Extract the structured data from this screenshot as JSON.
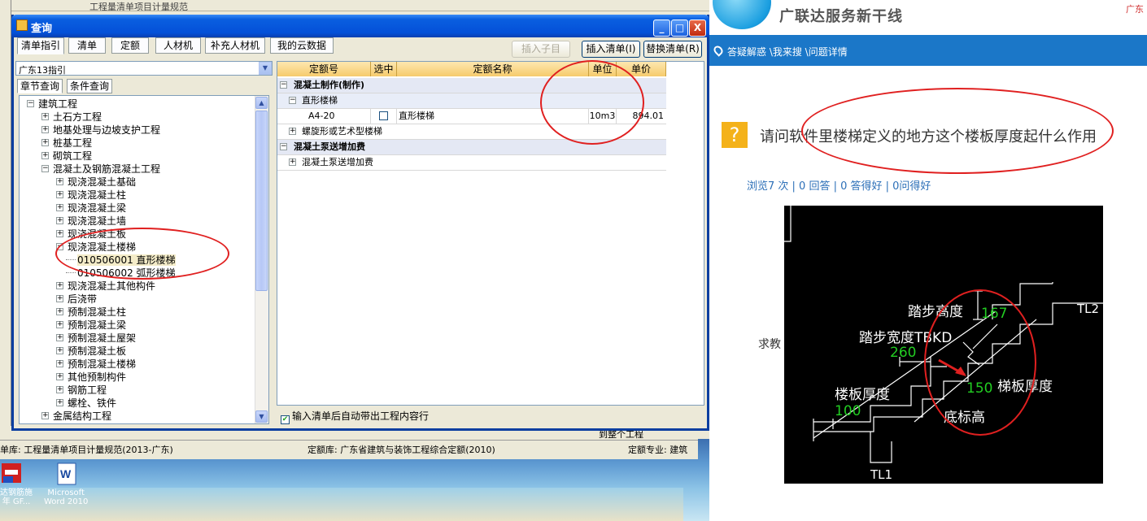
{
  "app": {
    "top_bar_text": "工程量清单项目计量规范",
    "status_left": "单库: 工程量清单项目计量规范(2013-广东)",
    "status_mid": "定额库: 广东省建筑与装饰工程综合定额(2010)",
    "status_right": "定额专业: 建筑",
    "behind_label": "到整个工程"
  },
  "dialog": {
    "title": "查询",
    "caption_min": "_",
    "caption_max": "□",
    "caption_close": "X",
    "tabs": [
      "清单指引",
      "清单",
      "定额",
      "人材机",
      "补充人材机",
      "我的云数据"
    ],
    "btn_insert_child": "插入子目",
    "btn_insert_list": "插入清单(I)",
    "btn_replace_list": "替换清单(R)",
    "combo_value": "广东13指引",
    "subtabs": [
      "章节查询",
      "条件查询"
    ],
    "tree": [
      {
        "label": "建筑工程",
        "level": 0,
        "sign": "−"
      },
      {
        "label": "土石方工程",
        "level": 1,
        "sign": "+"
      },
      {
        "label": "地基处理与边坡支护工程",
        "level": 1,
        "sign": "+"
      },
      {
        "label": "桩基工程",
        "level": 1,
        "sign": "+"
      },
      {
        "label": "砌筑工程",
        "level": 1,
        "sign": "+"
      },
      {
        "label": "混凝土及钢筋混凝土工程",
        "level": 1,
        "sign": "−"
      },
      {
        "label": "现浇混凝土基础",
        "level": 2,
        "sign": "+"
      },
      {
        "label": "现浇混凝土柱",
        "level": 2,
        "sign": "+"
      },
      {
        "label": "现浇混凝土梁",
        "level": 2,
        "sign": "+"
      },
      {
        "label": "现浇混凝土墙",
        "level": 2,
        "sign": "+"
      },
      {
        "label": "现浇混凝土板",
        "level": 2,
        "sign": "+"
      },
      {
        "label": "现浇混凝土楼梯",
        "level": 2,
        "sign": "−"
      },
      {
        "label": "010506001  直形楼梯",
        "level": 3,
        "sign": ""
      },
      {
        "label": "010506002  弧形楼梯",
        "level": 3,
        "sign": ""
      },
      {
        "label": "现浇混凝土其他构件",
        "level": 2,
        "sign": "+"
      },
      {
        "label": "后浇带",
        "level": 2,
        "sign": "+"
      },
      {
        "label": "预制混凝土柱",
        "level": 2,
        "sign": "+"
      },
      {
        "label": "预制混凝土梁",
        "level": 2,
        "sign": "+"
      },
      {
        "label": "预制混凝土屋架",
        "level": 2,
        "sign": "+"
      },
      {
        "label": "预制混凝土板",
        "level": 2,
        "sign": "+"
      },
      {
        "label": "预制混凝土楼梯",
        "level": 2,
        "sign": "+"
      },
      {
        "label": "其他预制构件",
        "level": 2,
        "sign": "+"
      },
      {
        "label": "钢筋工程",
        "level": 2,
        "sign": "+"
      },
      {
        "label": "螺栓、铁件",
        "level": 2,
        "sign": "+"
      },
      {
        "label": "金属结构工程",
        "level": 1,
        "sign": "+"
      }
    ],
    "grid_headers": [
      "定额号",
      "选中",
      "定额名称",
      "单位",
      "单价"
    ],
    "grid_rows": [
      {
        "group": "混凝土制作(制作)",
        "sign": "−",
        "bold": true
      },
      {
        "group": "直形楼梯",
        "sign": "−",
        "bold": false
      },
      {
        "code": "A4-20",
        "name": "直形楼梯",
        "unit": "10m3",
        "price": "894.01"
      },
      {
        "group": "螺旋形或艺术型楼梯",
        "sign": "+",
        "bold": false
      },
      {
        "group": "混凝土泵送增加费",
        "sign": "−",
        "bold": true
      },
      {
        "group": "混凝土泵送增加费",
        "sign": "+",
        "bold": false
      }
    ],
    "checkbox_label": "输入清单后自动带出工程内容行"
  },
  "desktop": {
    "icons": [
      {
        "name": "广联达钢筋施工 GF...",
        "label1": "达钢筋施",
        "label2": "年 GF..."
      },
      {
        "name": "Microsoft Word 2010",
        "label1": "Microsoft",
        "label2": "Word 2010"
      }
    ]
  },
  "web": {
    "brand": "广联达服务新干线",
    "corner": "广东",
    "breadcrumb": "答疑解惑 \\我来搜 \\问题详情",
    "question_badge": "?",
    "question_title": "请问软件里楼梯定义的地方这个楼板厚度起什么作用",
    "stats": "浏览7 次 | 0 回答 | 0 答得好 | 0问得好",
    "ask_text": "求教",
    "figure": {
      "labels": [
        "踏步高度",
        "167",
        "踏步宽度TBKD",
        "260",
        "150",
        "梯板厚度",
        "楼板厚度",
        "100",
        "底标高",
        "TL1",
        "TL2"
      ]
    }
  },
  "colors": {
    "accent_blue": "#1b77c8",
    "title_bar": "#0450d8",
    "annotation_red": "#e02020",
    "figure_green": "#22cc22"
  }
}
